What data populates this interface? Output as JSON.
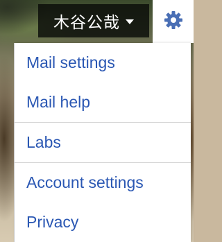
{
  "header": {
    "user_name": "木谷公哉",
    "user_caret_icon": "chevron-down-icon",
    "settings_icon": "gear-icon",
    "accent_color": "#2a57b3"
  },
  "menu": {
    "items": [
      {
        "label": "Mail settings"
      },
      {
        "label": "Mail help"
      },
      {
        "label": "Labs"
      },
      {
        "label": "Account settings"
      },
      {
        "label": "Privacy"
      }
    ]
  }
}
